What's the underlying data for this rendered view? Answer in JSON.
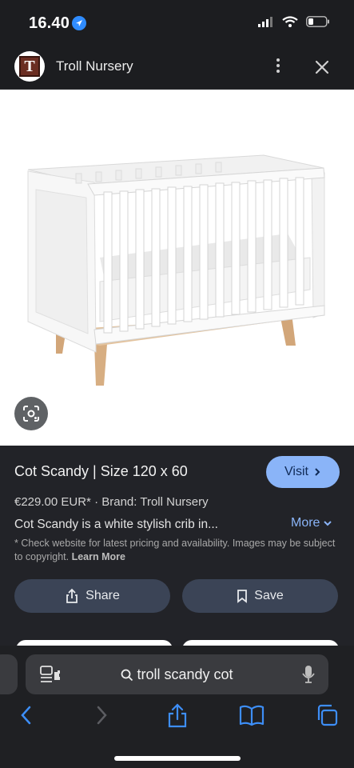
{
  "status_bar": {
    "time": "16.40"
  },
  "header": {
    "site_name": "Troll Nursery",
    "logo_letter": "T"
  },
  "product": {
    "title": "Cot Scandy | Size 120 x 60",
    "visit_label": "Visit",
    "price": "€229.00 EUR*",
    "brand": "Brand: Troll Nursery",
    "description": "Cot Scandy is a white stylish crib in...",
    "more_label": "More",
    "disclaimer": "* Check website for latest pricing and availability. Images may be subject to copyright.",
    "learn_more": "Learn More",
    "share_label": "Share",
    "save_label": "Save"
  },
  "browser": {
    "url_text": "troll scandy cot"
  },
  "colors": {
    "accent": "#8ab4f8",
    "button_bg": "#3b4456",
    "panel_bg": "#222328",
    "ios_blue": "#2f8cff"
  }
}
